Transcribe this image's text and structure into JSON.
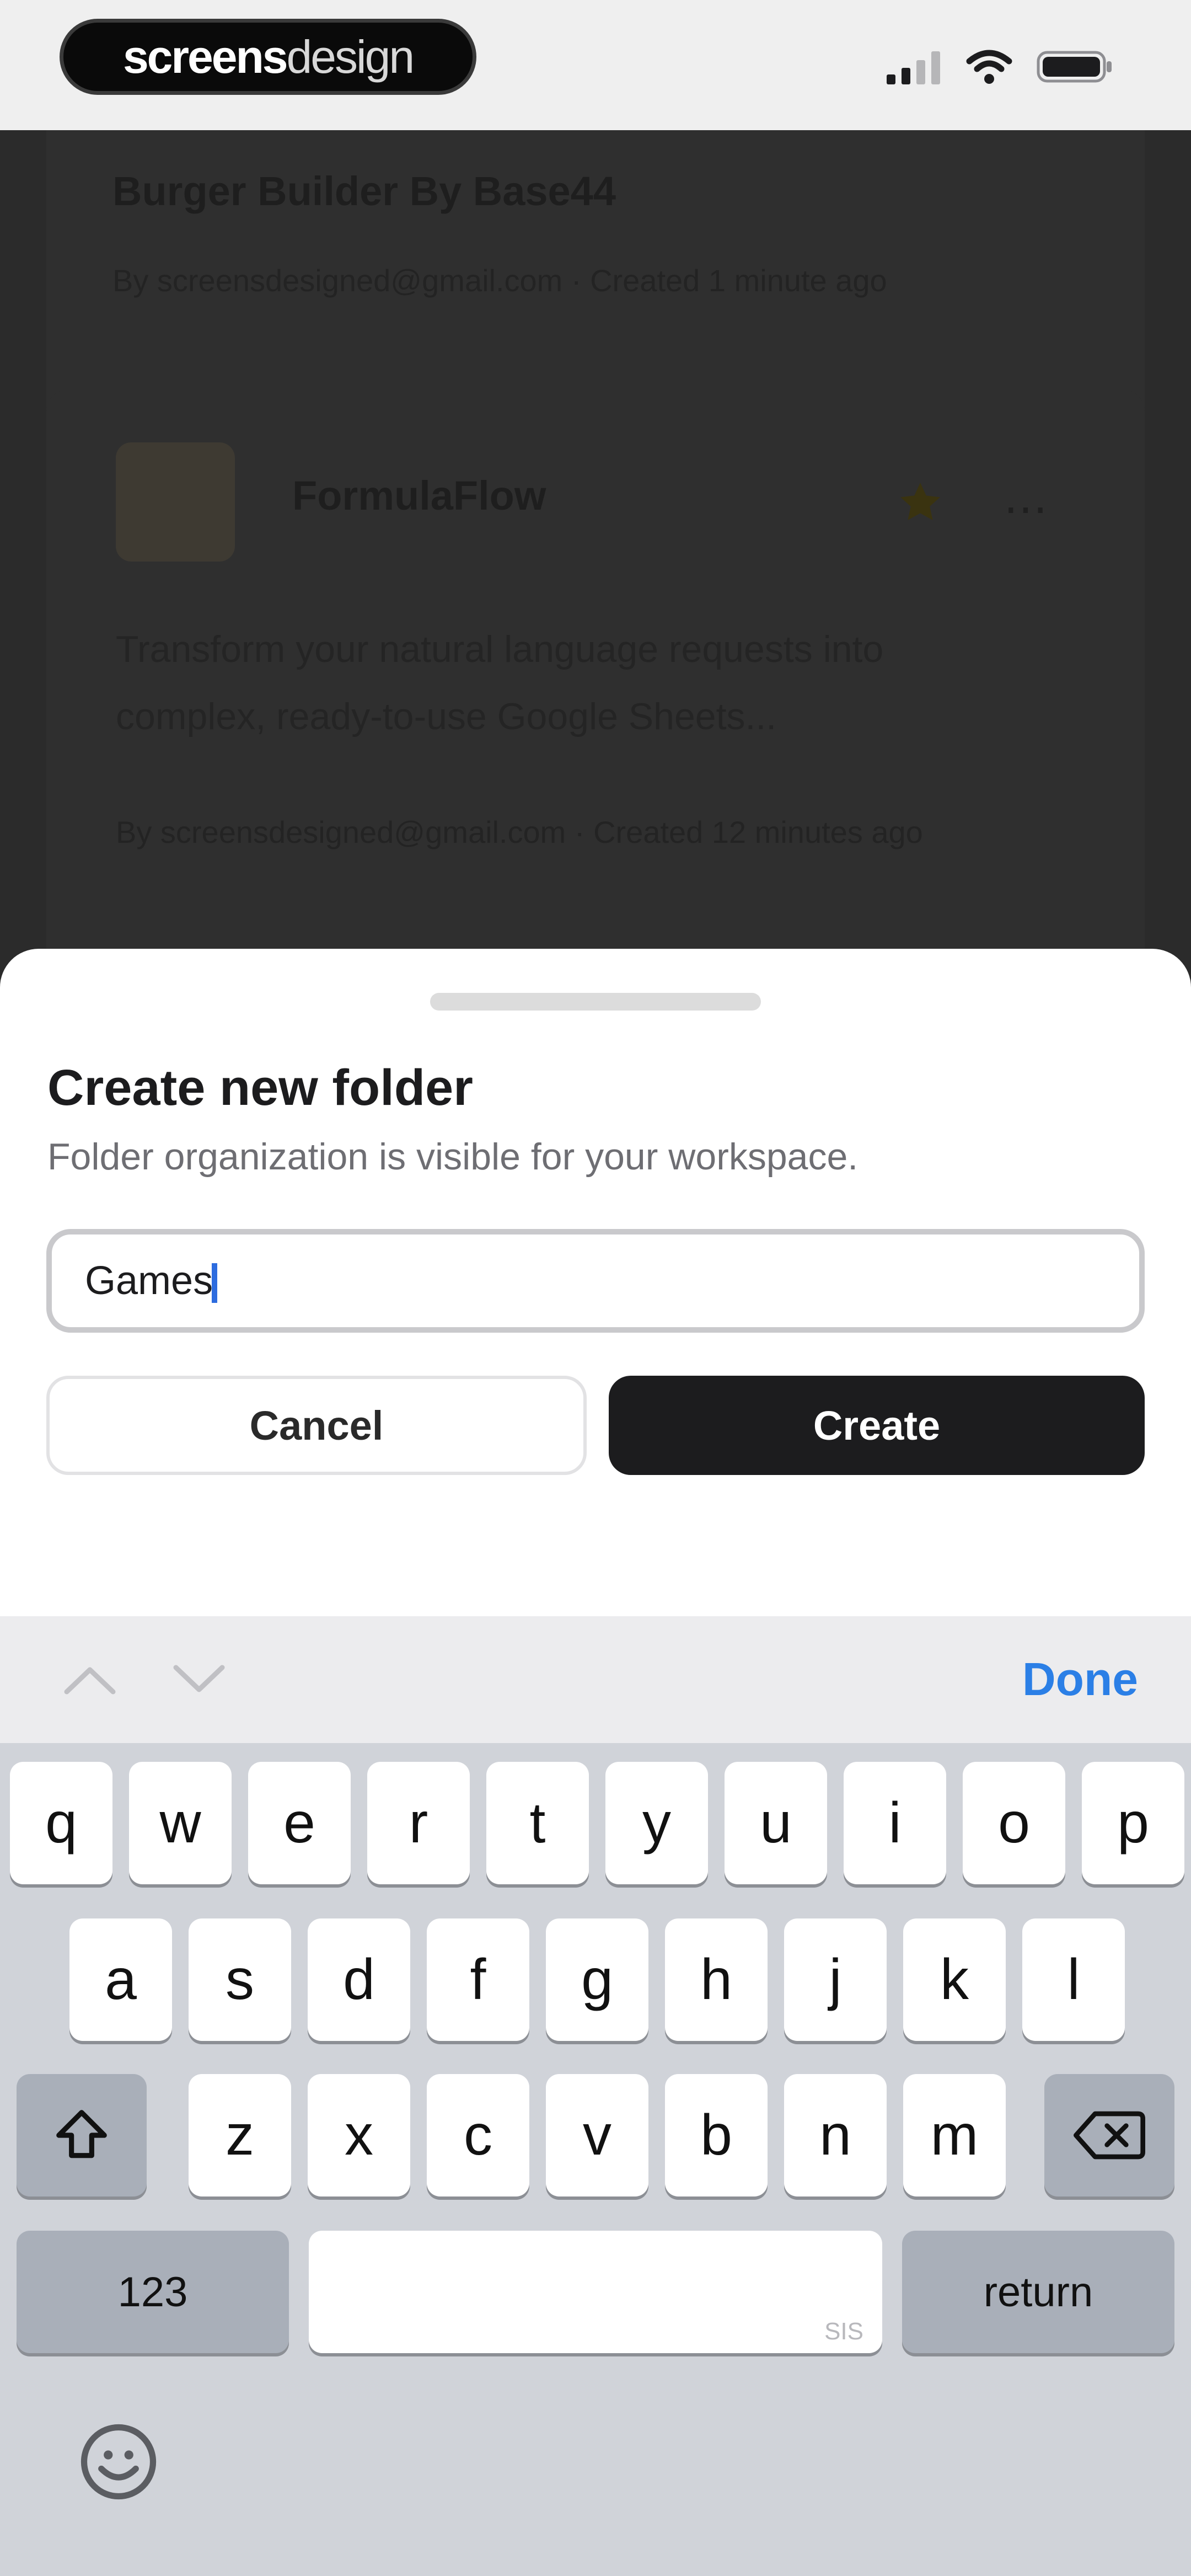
{
  "status_bar": {
    "logo_bold": "screens",
    "logo_light": "design"
  },
  "background": {
    "item1": {
      "title": "Burger Builder By Base44",
      "meta": "By screensdesigned@gmail.com · Created 1 minute ago"
    },
    "item2": {
      "title": "FormulaFlow",
      "description_line1": "Transform your natural language requests into",
      "description_line2": "complex, ready-to-use Google Sheets...",
      "meta": "By screensdesigned@gmail.com · Created 12 minutes ago",
      "star_color": "#c8a200"
    }
  },
  "sheet": {
    "title": "Create new folder",
    "subtitle": "Folder organization is visible for your workspace.",
    "input_value": "Games",
    "cancel_label": "Cancel",
    "create_label": "Create"
  },
  "keyboard_toolbar": {
    "done_label": "Done"
  },
  "keyboard": {
    "row1": [
      "q",
      "w",
      "e",
      "r",
      "t",
      "y",
      "u",
      "i",
      "o",
      "p"
    ],
    "row2": [
      "a",
      "s",
      "d",
      "f",
      "g",
      "h",
      "j",
      "k",
      "l"
    ],
    "row3": [
      "z",
      "x",
      "c",
      "v",
      "b",
      "n",
      "m"
    ],
    "numbers_label": "123",
    "return_label": "return",
    "space_hint": "SIS"
  },
  "colors": {
    "accent": "#2b7fe6",
    "primary_button": "#1c1c1e"
  }
}
